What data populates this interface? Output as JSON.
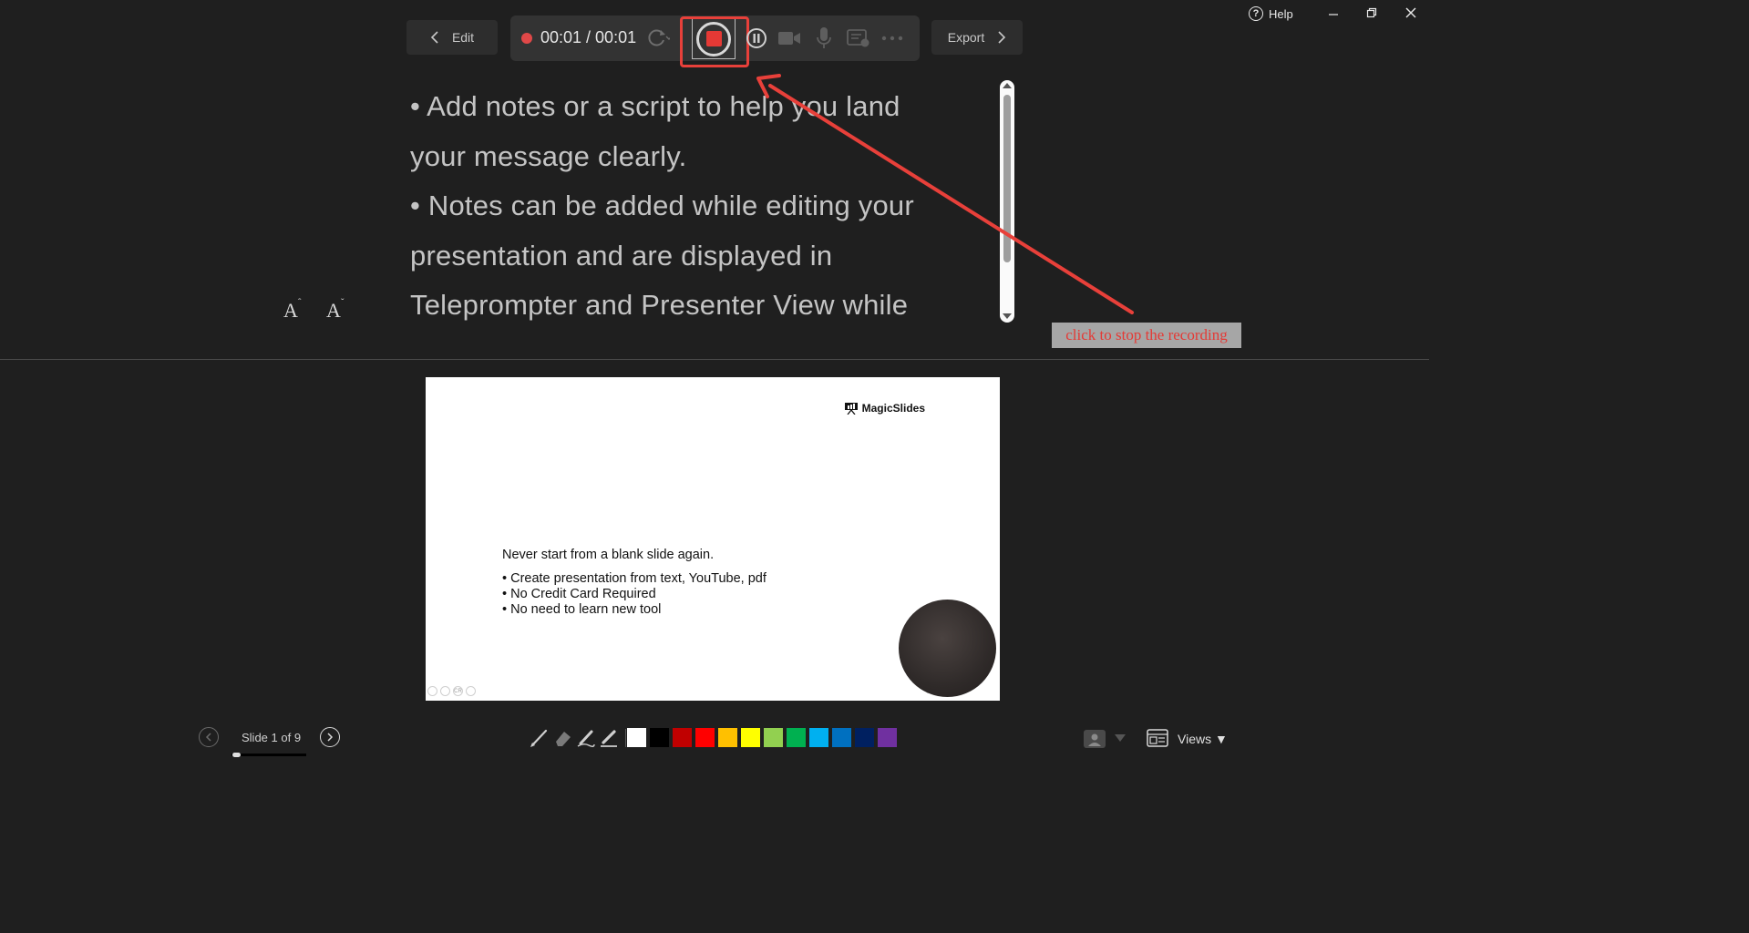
{
  "window": {
    "help_label": "Help",
    "help_glyph": "?",
    "minimize_icon": "minimize-icon",
    "restore_icon": "restore-icon",
    "close_icon": "close-icon"
  },
  "toolbar": {
    "edit_label": "Edit",
    "export_label": "Export",
    "timer": "00:01 / 00:01",
    "icons": [
      "record-dot-icon",
      "retake-icon",
      "stop-icon",
      "pause-icon",
      "camera-icon",
      "microphone-icon",
      "teleprompter-icon",
      "more-icon"
    ],
    "recording_color": "#e53935"
  },
  "notes": {
    "lines": [
      "• Add notes or a script to help you land",
      "your message clearly.",
      "• Notes can be added while editing your",
      "presentation and are displayed in",
      "Teleprompter and Presenter View while"
    ],
    "increase_font_label": "A",
    "decrease_font_label": "A"
  },
  "annotation": {
    "callout_text": "click to stop the recording",
    "color": "#e8403a"
  },
  "slide": {
    "logo_text": "MagicSlides",
    "heading": "Never start from a blank slide again.",
    "bullets": [
      "• Create presentation from text, YouTube, pdf",
      "• No Credit Card Required",
      "• No need to learn new tool"
    ],
    "ctrl_badge": "CR"
  },
  "footer": {
    "slide_counter": "Slide 1 of 9",
    "views_label": "Views ▼",
    "progress_fraction": 0.11,
    "pen_tools": [
      "pen-icon",
      "eraser-icon",
      "marker-icon",
      "highlighter-icon"
    ],
    "colors": [
      "#ffffff",
      "#000000",
      "#c00000",
      "#ff0000",
      "#ffc000",
      "#ffff00",
      "#92d050",
      "#00b050",
      "#00b0f0",
      "#0070c0",
      "#002060",
      "#7030a0"
    ]
  }
}
